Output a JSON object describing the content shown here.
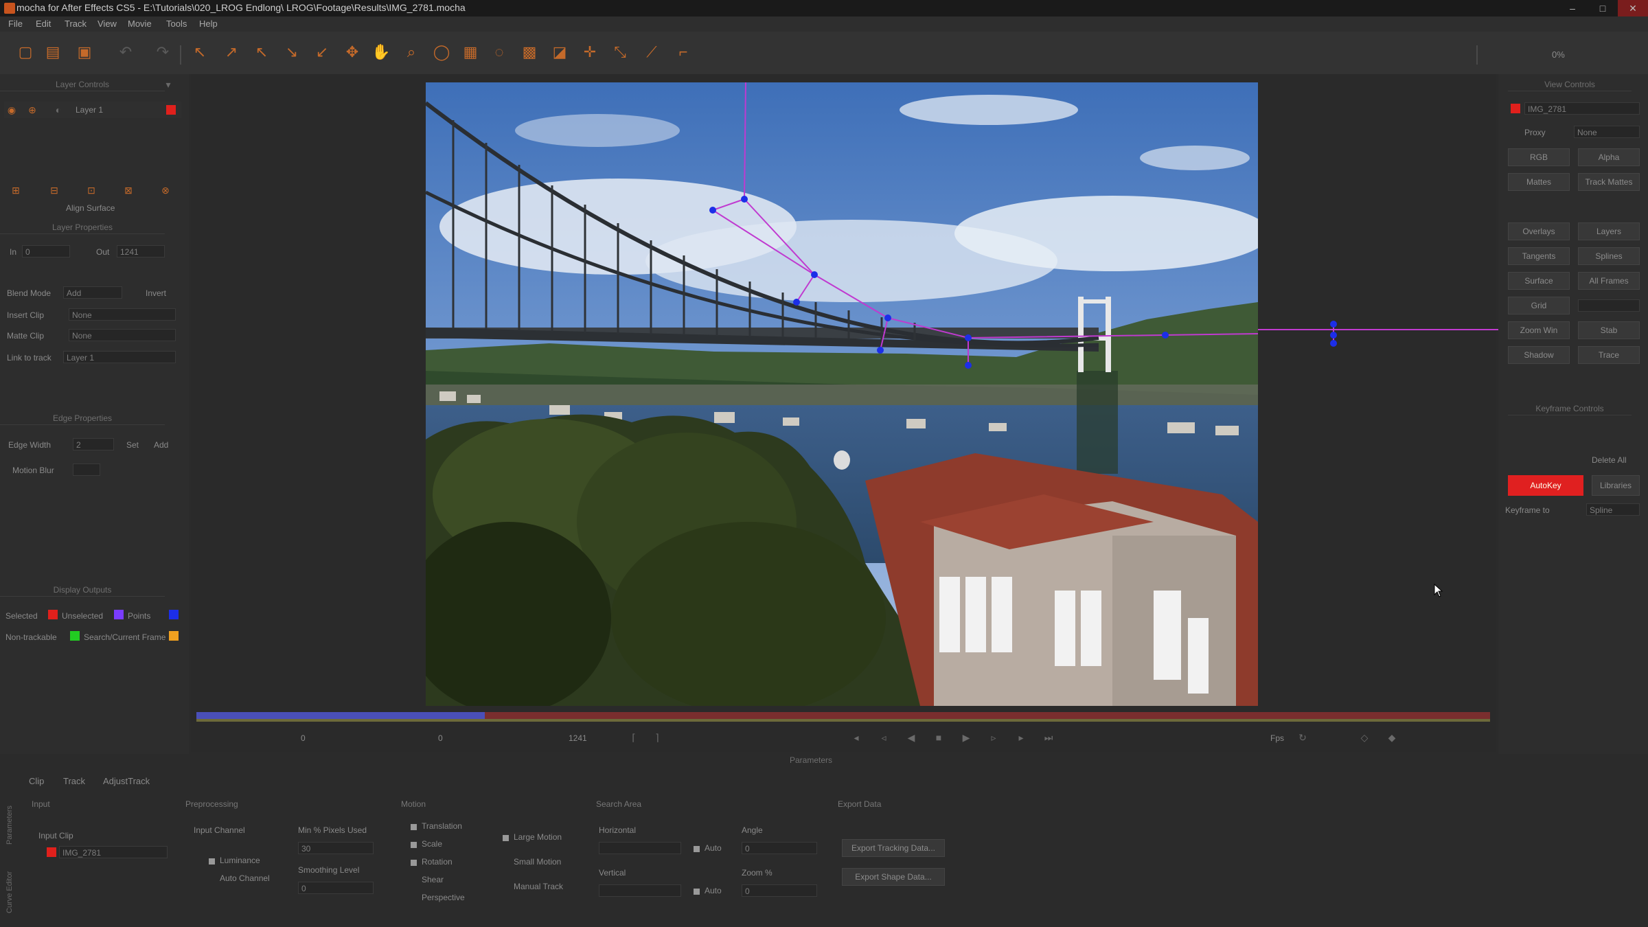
{
  "window": {
    "title": "mocha for After Effects CS5 - E:\\Tutorials\\020_LROG Endlong\\ LROG\\Footage\\Results\\IMG_2781.mocha",
    "controls": [
      "–",
      "□",
      "✕"
    ]
  },
  "menu": [
    "File",
    "Edit",
    "Track",
    "View",
    "Movie",
    "Tools",
    "Help"
  ],
  "toolbar": {
    "zoom": "0%"
  },
  "left_panel": {
    "layer_controls": "Layer Controls",
    "layer_name": "Layer 1",
    "align_surface": "Align Surface",
    "layer_properties": "Layer Properties",
    "in_label": "In",
    "in_value": "0",
    "out_label": "Out",
    "out_value": "1241",
    "blend_mode_label": "Blend Mode",
    "blend_mode_value": "Add",
    "invert_label": "Invert",
    "insert_clip_label": "Insert Clip",
    "insert_clip_value": "None",
    "matte_clip_label": "Matte Clip",
    "matte_clip_value": "None",
    "link_to_track_label": "Link to track",
    "link_to_track_value": "Layer 1",
    "edge_properties": "Edge Properties",
    "edge_width_label": "Edge Width",
    "edge_width_value": "2",
    "set_label": "Set",
    "add_label": "Add",
    "motion_blur_label": "Motion Blur",
    "display_outputs": "Display Outputs",
    "selected_label": "Selected",
    "unselected_label": "Unselected",
    "points_label": "Points",
    "non_trackable_label": "Non-trackable",
    "search_frame_label": "Search/Current Frame"
  },
  "right_panel": {
    "view_controls": "View Controls",
    "clip_name": "IMG_2781",
    "proxy_label": "Proxy",
    "proxy_value": "None",
    "rgb": "RGB",
    "alpha": "Alpha",
    "mattes": "Mattes",
    "track_mattes": "Track Mattes",
    "overlays": "Overlays",
    "layers": "Layers",
    "tangents": "Tangents",
    "splines": "Splines",
    "surface": "Surface",
    "all_frames": "All Frames",
    "grid": "Grid",
    "zoom_win": "Zoom Win",
    "stab": "Stab",
    "shadow": "Shadow",
    "trace": "Trace",
    "keyframe_controls": "Keyframe Controls",
    "delete_all": "Delete All",
    "autokey": "AutoKey",
    "libraries": "Libraries",
    "keyframe_to": "Keyframe to",
    "keyframe_to_value": "Spline"
  },
  "timeline": {
    "frame_in": "0",
    "frame_current": "0",
    "frame_out": "1241",
    "fps_label": "Fps"
  },
  "params": {
    "header": "Parameters",
    "tabs": [
      "Clip",
      "Track",
      "AdjustTrack"
    ],
    "side_tabs": [
      "Parameters",
      "Curve Editor"
    ],
    "input_head": "Input",
    "input_clip_label": "Input Clip",
    "input_clip_value": "IMG_2781",
    "preprocessing_head": "Preprocessing",
    "input_channel_label": "Input Channel",
    "luminance": "Luminance",
    "auto_channel": "Auto Channel",
    "min_pixels_label": "Min % Pixels Used",
    "min_pixels_value": "30",
    "smoothing_label": "Smoothing Level",
    "smoothing_value": "0",
    "motion_head": "Motion",
    "translation": "Translation",
    "scale": "Scale",
    "rotation": "Rotation",
    "shear": "Shear",
    "perspective": "Perspective",
    "large_motion": "Large Motion",
    "small_motion": "Small Motion",
    "manual_track": "Manual Track",
    "search_area_head": "Search Area",
    "horizontal_label": "Horizontal",
    "vertical_label": "Vertical",
    "auto_label": "Auto",
    "angle_label": "Angle",
    "angle_value": "0",
    "zoom_label": "Zoom %",
    "zoom_value": "0",
    "export_data_head": "Export Data",
    "export_tracking": "Export Tracking Data...",
    "export_shape": "Export Shape Data..."
  },
  "colors": {
    "accent": "#c8541e",
    "selected": "#e0201c",
    "points": "#7a3cff",
    "unselected_point": "#1c2ee8",
    "non_trackable": "#22cc22",
    "search_frame": "#f0a020",
    "spline": "#c03ad0"
  }
}
